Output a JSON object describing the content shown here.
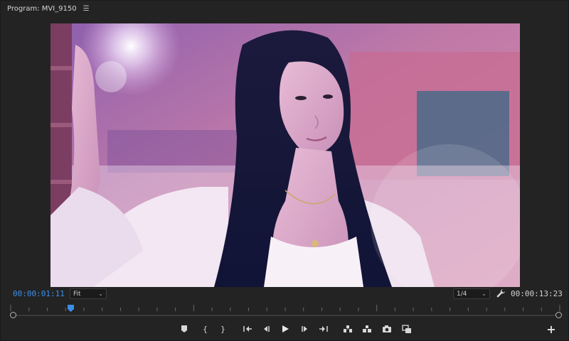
{
  "header": {
    "title": "Program: MVI_9150",
    "menu_icon": "hamburger-icon"
  },
  "viewer": {
    "content": "video-frame"
  },
  "info": {
    "timecode_current": "00:00:01:11",
    "zoom_select": "Fit",
    "resolution_select": "1/4",
    "timecode_duration": "00:00:13:23"
  },
  "timeline": {
    "playhead_fraction": 0.11
  },
  "transport_icons": [
    "marker-icon",
    "mark-in-icon",
    "mark-out-icon",
    "go-to-in-icon",
    "step-back-icon",
    "play-icon",
    "step-forward-icon",
    "go-to-out-icon",
    "lift-icon",
    "extract-icon",
    "export-frame-icon",
    "compare-icon"
  ],
  "colors": {
    "accent": "#3b8ee6",
    "panel": "#232323",
    "text": "#cfcfcf"
  }
}
